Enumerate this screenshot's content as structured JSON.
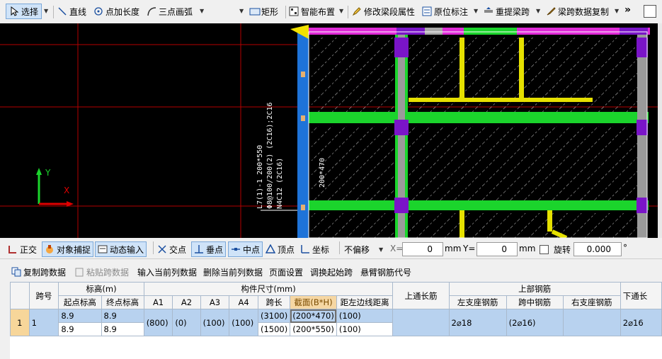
{
  "toolbar": {
    "select": "选择",
    "line": "直线",
    "point_length": "点加长度",
    "three_point_arc": "三点画弧",
    "rectangle": "矩形",
    "smart_layout": "智能布置",
    "modify_beam_props": "修改梁段属性",
    "in_situ_annotation": "原位标注",
    "re_extract_span": "重提梁跨",
    "copy_span_data": "梁跨数据复制",
    "more": "»"
  },
  "canvas": {
    "beam_label_lines": [
      "L7(1)-1 200*550",
      "Φ8@100/200(2) (2C16);2C16",
      "N4C12 (2C16)"
    ],
    "section_label": "200*470",
    "axis_y": "Y",
    "axis_x": "X",
    "colors": {
      "background": "#000000",
      "wall_green": "#1bd42c",
      "beam_yellow": "#e5e000",
      "column_purple": "#7a14c8",
      "edge_magenta": "#e02ad8",
      "left_beam_blue": "#1e73d8",
      "grid_red": "#b40000"
    }
  },
  "snapbar": {
    "ortho": "正交",
    "object_snap": "对象捕捉",
    "dynamic_input": "动态输入",
    "intersection": "交点",
    "perpendicular": "垂点",
    "midpoint": "中点",
    "vertex": "顶点",
    "coordinate": "坐标",
    "offset_mode": "不偏移",
    "x_label": "X=",
    "x_value": "0",
    "x_unit": "mm",
    "y_label": "Y=",
    "y_value": "0",
    "y_unit": "mm",
    "rotate_label": "旋转",
    "rotate_value": "0.000",
    "degree": "°"
  },
  "actionbar": {
    "copy_span": "复制跨数据",
    "paste_span": "粘贴跨数据",
    "input_prev_col": "输入当前列数据",
    "delete_prev_col": "删除当前列数据",
    "page_setup": "页面设置",
    "adjust_start_span": "调换起始跨",
    "cantilever_code": "悬臂钢筋代号"
  },
  "grid": {
    "headers": {
      "span_no": "跨号",
      "elevation": "标高(m)",
      "start_elev": "起点标高",
      "end_elev": "终点标高",
      "component_size": "构件尺寸(mm)",
      "a1": "A1",
      "a2": "A2",
      "a3": "A3",
      "a4": "A4",
      "span_length": "跨长",
      "section": "截面(B*H)",
      "dist_left": "距左边线距离",
      "top_through": "上通长筋",
      "top_rebar": "上部钢筋",
      "left_support": "左支座钢筋",
      "mid_span": "跨中钢筋",
      "right_support": "右支座钢筋",
      "bottom_through": "下通长"
    },
    "row": {
      "row_num": "1",
      "span": "1",
      "start_elev_1": "8.9",
      "end_elev_1": "8.9",
      "start_elev_2": "8.9",
      "end_elev_2": "8.9",
      "a1": "(800)",
      "a2": "(0)",
      "a3": "(100)",
      "a4": "(100)",
      "span_len_1": "(3100)",
      "span_len_2": "(1500)",
      "section_1": "(200*470)",
      "section_2": "(200*550)",
      "dist_1": "(100)",
      "dist_2": "(100)",
      "top_through": "",
      "left_support": "2⌀18",
      "mid_span": "(2⌀16)",
      "right_support": "",
      "bottom_through": "2⌀16"
    }
  }
}
